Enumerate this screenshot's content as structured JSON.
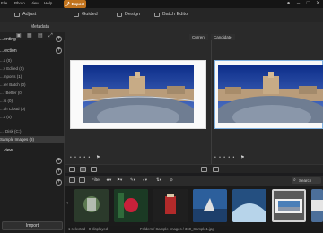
{
  "menubar": {
    "items": [
      "File",
      "Photo",
      "View",
      "Help"
    ],
    "export_label": "Export"
  },
  "modes": {
    "adjust": "Adjust",
    "guided": "Guided",
    "design": "Design",
    "batch": "Batch Editor"
  },
  "sidebar": {
    "tabs": [
      "Library",
      "Metadata"
    ],
    "sections": {
      "tagging": "...enting",
      "collection": "...lection",
      "review": "...view"
    },
    "collection_items": [
      "...s (0)",
      "...y Edited (0)",
      "...mports (1)",
      "...ter Batch (0)",
      "...r Better (0)",
      "...ts (0)",
      "...sh Cloud (0)",
      "...s (0)"
    ],
    "drives": "...l Disk (C:)",
    "selected_folder": "Sample Images (8)",
    "import_label": "Import"
  },
  "compare": {
    "current": "Current",
    "candidate": "Candidate"
  },
  "viewer": {
    "rating_dots": "• • • • •"
  },
  "filmstrip": {
    "filter_label": "Filter",
    "search_label": "Search",
    "thumbs": [
      {
        "color": "#2b3a2b",
        "accent": "#d8d8d8"
      },
      {
        "color": "#1b3a24",
        "accent": "#c8213a"
      },
      {
        "color": "#1f1f1f",
        "accent": "#b22a2a"
      },
      {
        "color": "#2c5f9c",
        "accent": "#e0e0e0"
      },
      {
        "color": "#244f80",
        "accent": "#b7d4ea"
      },
      {
        "color": "#c8c8c8",
        "accent": "#4b7fb8"
      },
      {
        "color": "#4c6f9a",
        "accent": "#e5e5e5"
      }
    ]
  },
  "status": {
    "selection": "1 selected · 8 displayed",
    "path": "Folders / Sample Images / 360_Sample1.jpg"
  },
  "colors": {
    "accent_orange": "#c1731d",
    "selection_blue": "#7fb0df"
  }
}
